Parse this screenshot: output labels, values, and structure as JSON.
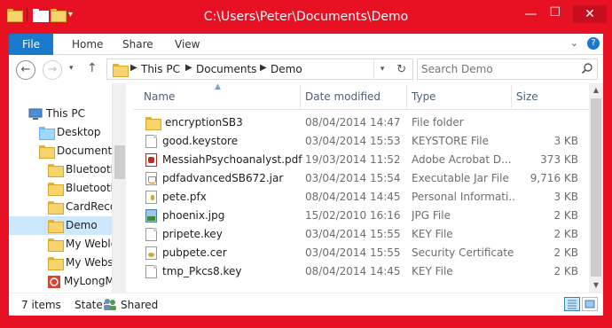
{
  "window": {
    "title": "C:\\Users\\Peter\\Documents\\Demo",
    "qat_dropdown": "▾",
    "controls": {
      "minimize": "—",
      "maximize": "☐",
      "close": "✕"
    }
  },
  "ribbon": {
    "tabs": [
      {
        "label": "File"
      },
      {
        "label": "Home"
      },
      {
        "label": "Share"
      },
      {
        "label": "View"
      }
    ],
    "expand_icon": "⌄",
    "help_icon": "?"
  },
  "navbar": {
    "back": "←",
    "forward": "→",
    "recent": "▾",
    "up": "↑",
    "breadcrumb": [
      "This PC",
      "Documents",
      "Demo"
    ],
    "separator": "▶",
    "dropdown": "▾",
    "refresh": "↻",
    "search_placeholder": "Search Demo"
  },
  "navpane": {
    "items": [
      {
        "label": "This PC",
        "icon": "computer-icon"
      },
      {
        "label": "Desktop",
        "icon": "folder-icon"
      },
      {
        "label": "Documents",
        "icon": "folder-icon"
      },
      {
        "label": "Bluetooth",
        "icon": "folder-icon"
      },
      {
        "label": "Bluetooth",
        "icon": "folder-icon"
      },
      {
        "label": "CardRecov",
        "icon": "folder-icon"
      },
      {
        "label": "Demo",
        "icon": "folder-icon",
        "selected": true
      },
      {
        "label": "My Weblo",
        "icon": "folder-icon"
      },
      {
        "label": "My Webs",
        "icon": "folder-icon"
      },
      {
        "label": "MyLongM",
        "icon": "app-icon"
      }
    ]
  },
  "columns": {
    "name": "Name",
    "date": "Date modified",
    "type": "Type",
    "size": "Size"
  },
  "files": [
    {
      "name": "encryptionSB3",
      "date": "08/04/2014 14:47",
      "type": "File folder",
      "size": "",
      "icon": "folder"
    },
    {
      "name": "good.keystore",
      "date": "03/04/2014 15:53",
      "type": "KEYSTORE File",
      "size": "3 KB",
      "icon": "doc"
    },
    {
      "name": "MessiahPsychoanalyst.pdf",
      "date": "19/03/2014 11:52",
      "type": "Adobe Acrobat D...",
      "size": "373 KB",
      "icon": "pdf"
    },
    {
      "name": "pdfadvancedSB672.jar",
      "date": "03/04/2014 15:54",
      "type": "Executable Jar File",
      "size": "9,716 KB",
      "icon": "jar"
    },
    {
      "name": "pete.pfx",
      "date": "08/04/2014 14:45",
      "type": "Personal Informati...",
      "size": "3 KB",
      "icon": "pfx"
    },
    {
      "name": "phoenix.jpg",
      "date": "15/02/2010 16:16",
      "type": "JPG File",
      "size": "2 KB",
      "icon": "jpg"
    },
    {
      "name": "pripete.key",
      "date": "03/04/2014 15:55",
      "type": "KEY File",
      "size": "2 KB",
      "icon": "doc"
    },
    {
      "name": "pubpete.cer",
      "date": "03/04/2014 15:55",
      "type": "Security Certificate",
      "size": "2 KB",
      "icon": "cer"
    },
    {
      "name": "tmp_Pkcs8.key",
      "date": "08/04/2014 14:45",
      "type": "KEY File",
      "size": "2 KB",
      "icon": "doc"
    }
  ],
  "status": {
    "items": "7 items",
    "state_label": "State:",
    "state_value": "Shared"
  },
  "colors": {
    "frame": "#e81123",
    "file_tab": "#1979ca",
    "selected": "#cce8ff"
  }
}
